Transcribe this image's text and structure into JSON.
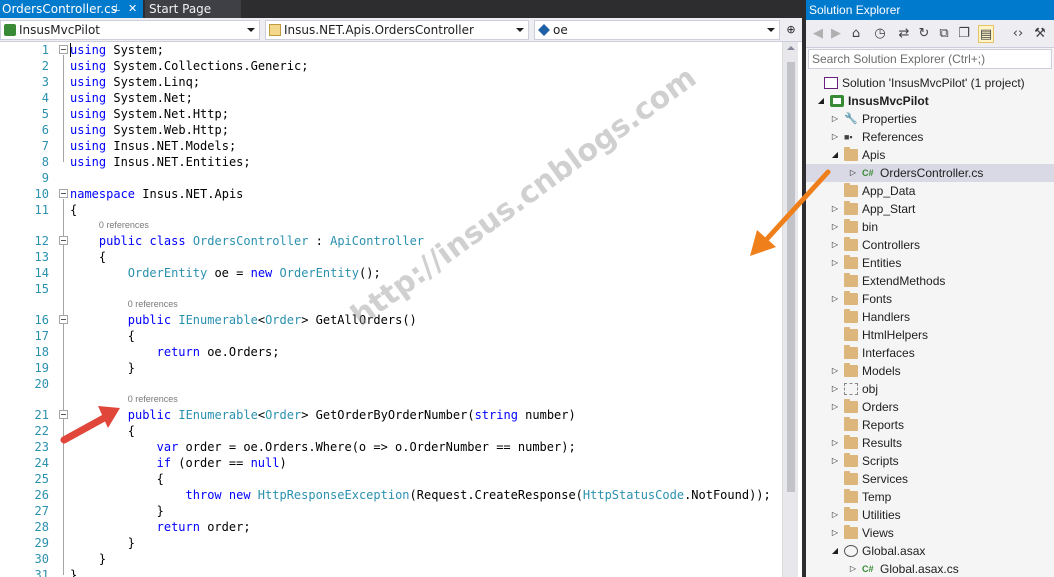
{
  "editor": {
    "tabs": [
      {
        "label": "OrdersController.cs",
        "active": true,
        "pin_icon": "pin-icon",
        "close_icon": "close-icon"
      },
      {
        "label": "Start Page",
        "active": false
      }
    ],
    "nav": {
      "project": "InsusMvcPilot",
      "class": "Insus.NET.Apis.OrdersController",
      "member": "oe"
    },
    "lines": [
      {
        "n": "1",
        "tokens": [
          {
            "t": "using",
            "c": "kw"
          },
          {
            "t": " System;",
            "c": "pl"
          }
        ]
      },
      {
        "n": "2",
        "tokens": [
          {
            "t": "using",
            "c": "kw"
          },
          {
            "t": " System.Collections.Generic;",
            "c": "pl"
          }
        ]
      },
      {
        "n": "3",
        "tokens": [
          {
            "t": "using",
            "c": "kw"
          },
          {
            "t": " System.Linq;",
            "c": "pl"
          }
        ]
      },
      {
        "n": "4",
        "tokens": [
          {
            "t": "using",
            "c": "kw"
          },
          {
            "t": " System.Net;",
            "c": "pl"
          }
        ]
      },
      {
        "n": "5",
        "tokens": [
          {
            "t": "using",
            "c": "kw"
          },
          {
            "t": " System.Net.Http;",
            "c": "pl"
          }
        ]
      },
      {
        "n": "6",
        "tokens": [
          {
            "t": "using",
            "c": "kw"
          },
          {
            "t": " System.Web.Http;",
            "c": "pl"
          }
        ]
      },
      {
        "n": "7",
        "tokens": [
          {
            "t": "using",
            "c": "kw"
          },
          {
            "t": " Insus.NET.Models;",
            "c": "pl"
          }
        ]
      },
      {
        "n": "8",
        "tokens": [
          {
            "t": "using",
            "c": "kw"
          },
          {
            "t": " Insus.NET.Entities;",
            "c": "pl"
          }
        ]
      },
      {
        "n": "9",
        "tokens": []
      },
      {
        "n": "10",
        "tokens": [
          {
            "t": "namespace",
            "c": "kw"
          },
          {
            "t": " Insus.NET.Apis",
            "c": "pl"
          }
        ]
      },
      {
        "n": "11",
        "tokens": [
          {
            "t": "{",
            "c": "pl"
          }
        ]
      },
      {
        "n": "12",
        "ref": "0 references",
        "indent": 4,
        "tokens": [
          {
            "t": "public",
            "c": "kw"
          },
          {
            "t": " ",
            "c": "pl"
          },
          {
            "t": "class",
            "c": "kw"
          },
          {
            "t": " ",
            "c": "pl"
          },
          {
            "t": "OrdersController",
            "c": "ty"
          },
          {
            "t": " : ",
            "c": "pl"
          },
          {
            "t": "ApiController",
            "c": "ty"
          }
        ]
      },
      {
        "n": "13",
        "indent": 4,
        "tokens": [
          {
            "t": "{",
            "c": "pl"
          }
        ]
      },
      {
        "n": "14",
        "indent": 8,
        "tokens": [
          {
            "t": "OrderEntity",
            "c": "ty"
          },
          {
            "t": " oe = ",
            "c": "pl"
          },
          {
            "t": "new",
            "c": "kw"
          },
          {
            "t": " ",
            "c": "pl"
          },
          {
            "t": "OrderEntity",
            "c": "ty"
          },
          {
            "t": "();",
            "c": "pl"
          }
        ]
      },
      {
        "n": "15",
        "tokens": []
      },
      {
        "n": "16",
        "ref": "0 references",
        "indent": 8,
        "tokens": [
          {
            "t": "public",
            "c": "kw"
          },
          {
            "t": " ",
            "c": "pl"
          },
          {
            "t": "IEnumerable",
            "c": "ty"
          },
          {
            "t": "<",
            "c": "pl"
          },
          {
            "t": "Order",
            "c": "ty"
          },
          {
            "t": "> GetAllOrders()",
            "c": "pl"
          }
        ]
      },
      {
        "n": "17",
        "indent": 8,
        "tokens": [
          {
            "t": "{",
            "c": "pl"
          }
        ]
      },
      {
        "n": "18",
        "indent": 12,
        "tokens": [
          {
            "t": "return",
            "c": "kw"
          },
          {
            "t": " oe.Orders;",
            "c": "pl"
          }
        ]
      },
      {
        "n": "19",
        "indent": 8,
        "tokens": [
          {
            "t": "}",
            "c": "pl"
          }
        ]
      },
      {
        "n": "20",
        "tokens": []
      },
      {
        "n": "21",
        "ref": "0 references",
        "indent": 8,
        "tokens": [
          {
            "t": "public",
            "c": "kw"
          },
          {
            "t": " ",
            "c": "pl"
          },
          {
            "t": "IEnumerable",
            "c": "ty"
          },
          {
            "t": "<",
            "c": "pl"
          },
          {
            "t": "Order",
            "c": "ty"
          },
          {
            "t": "> GetOrderByOrderNumber(",
            "c": "pl"
          },
          {
            "t": "string",
            "c": "kw"
          },
          {
            "t": " number)",
            "c": "pl"
          }
        ]
      },
      {
        "n": "22",
        "indent": 8,
        "tokens": [
          {
            "t": "{",
            "c": "pl"
          }
        ]
      },
      {
        "n": "23",
        "indent": 12,
        "tokens": [
          {
            "t": "var",
            "c": "kw"
          },
          {
            "t": " order = oe.Orders.Where(o => o.OrderNumber == number);",
            "c": "pl"
          }
        ]
      },
      {
        "n": "24",
        "indent": 12,
        "tokens": [
          {
            "t": "if",
            "c": "kw"
          },
          {
            "t": " (order == ",
            "c": "pl"
          },
          {
            "t": "null",
            "c": "kw"
          },
          {
            "t": ")",
            "c": "pl"
          }
        ]
      },
      {
        "n": "25",
        "indent": 12,
        "tokens": [
          {
            "t": "{",
            "c": "pl"
          }
        ]
      },
      {
        "n": "26",
        "indent": 16,
        "tokens": [
          {
            "t": "throw",
            "c": "kw"
          },
          {
            "t": " ",
            "c": "pl"
          },
          {
            "t": "new",
            "c": "kw"
          },
          {
            "t": " ",
            "c": "pl"
          },
          {
            "t": "HttpResponseException",
            "c": "ty"
          },
          {
            "t": "(Request.CreateResponse(",
            "c": "pl"
          },
          {
            "t": "HttpStatusCode",
            "c": "ty"
          },
          {
            "t": ".NotFound));",
            "c": "pl"
          }
        ]
      },
      {
        "n": "27",
        "indent": 12,
        "tokens": [
          {
            "t": "}",
            "c": "pl"
          }
        ]
      },
      {
        "n": "28",
        "indent": 12,
        "tokens": [
          {
            "t": "return",
            "c": "kw"
          },
          {
            "t": " order;",
            "c": "pl"
          }
        ]
      },
      {
        "n": "29",
        "indent": 8,
        "tokens": [
          {
            "t": "}",
            "c": "pl"
          }
        ]
      },
      {
        "n": "30",
        "indent": 4,
        "tokens": [
          {
            "t": "}",
            "c": "pl"
          }
        ]
      },
      {
        "n": "31",
        "tokens": [
          {
            "t": "}",
            "c": "pl"
          }
        ]
      }
    ],
    "colors": {
      "keyword": "#0000ff",
      "type": "#2b91af",
      "line_number": "#2b91af",
      "tab_active": "#007acc"
    }
  },
  "solution_explorer": {
    "title": "Solution Explorer",
    "title_icons": [
      "pin-icon",
      "close-icon"
    ],
    "toolbar": [
      "back-icon",
      "forward-icon",
      "home-icon",
      "history-icon",
      "sync-icon",
      "refresh-icon",
      "collapse-all-icon",
      "show-all-files-icon",
      "view-code-icon",
      "properties-icon"
    ],
    "search_placeholder": "Search Solution Explorer (Ctrl+;)",
    "tree": [
      {
        "label": "Solution 'InsusMvcPilot' (1 project)",
        "icon": "solution-icon",
        "depth": 0,
        "expander": ""
      },
      {
        "label": "InsusMvcPilot",
        "icon": "project-icon",
        "depth": 0,
        "expander": "expanded",
        "bold": true
      },
      {
        "label": "Properties",
        "icon": "wrench-icon",
        "depth": 1,
        "expander": "collapsed"
      },
      {
        "label": "References",
        "icon": "references-icon",
        "depth": 1,
        "expander": "collapsed"
      },
      {
        "label": "Apis",
        "icon": "folder-open-icon",
        "depth": 1,
        "expander": "expanded"
      },
      {
        "label": "OrdersController.cs",
        "icon": "csharp-file-icon",
        "depth": 2,
        "expander": "collapsed",
        "selected": true
      },
      {
        "label": "App_Data",
        "icon": "folder-icon",
        "depth": 1,
        "expander": ""
      },
      {
        "label": "App_Start",
        "icon": "folder-icon",
        "depth": 1,
        "expander": "collapsed"
      },
      {
        "label": "bin",
        "icon": "folder-icon",
        "depth": 1,
        "expander": "collapsed"
      },
      {
        "label": "Controllers",
        "icon": "folder-icon",
        "depth": 1,
        "expander": "collapsed"
      },
      {
        "label": "Entities",
        "icon": "folder-icon",
        "depth": 1,
        "expander": "collapsed"
      },
      {
        "label": "ExtendMethods",
        "icon": "folder-icon",
        "depth": 1,
        "expander": ""
      },
      {
        "label": "Fonts",
        "icon": "folder-icon",
        "depth": 1,
        "expander": "collapsed"
      },
      {
        "label": "Handlers",
        "icon": "folder-icon",
        "depth": 1,
        "expander": ""
      },
      {
        "label": "HtmlHelpers",
        "icon": "folder-icon",
        "depth": 1,
        "expander": ""
      },
      {
        "label": "Interfaces",
        "icon": "folder-icon",
        "depth": 1,
        "expander": ""
      },
      {
        "label": "Models",
        "icon": "folder-icon",
        "depth": 1,
        "expander": "collapsed"
      },
      {
        "label": "obj",
        "icon": "folder-dotted-icon",
        "depth": 1,
        "expander": "collapsed"
      },
      {
        "label": "Orders",
        "icon": "folder-icon",
        "depth": 1,
        "expander": "collapsed"
      },
      {
        "label": "Reports",
        "icon": "folder-icon",
        "depth": 1,
        "expander": ""
      },
      {
        "label": "Results",
        "icon": "folder-icon",
        "depth": 1,
        "expander": "collapsed"
      },
      {
        "label": "Scripts",
        "icon": "folder-icon",
        "depth": 1,
        "expander": "collapsed"
      },
      {
        "label": "Services",
        "icon": "folder-icon",
        "depth": 1,
        "expander": ""
      },
      {
        "label": "Temp",
        "icon": "folder-icon",
        "depth": 1,
        "expander": ""
      },
      {
        "label": "Utilities",
        "icon": "folder-icon",
        "depth": 1,
        "expander": "collapsed"
      },
      {
        "label": "Views",
        "icon": "folder-icon",
        "depth": 1,
        "expander": "collapsed"
      },
      {
        "label": "Global.asax",
        "icon": "global-asax-icon",
        "depth": 1,
        "expander": "expanded"
      },
      {
        "label": "Global.asax.cs",
        "icon": "csharp-file-icon",
        "depth": 2,
        "expander": "collapsed"
      }
    ]
  },
  "watermark": "http://insus.cnblogs.com",
  "annotations": {
    "arrow_colors": [
      "#ef7f1a",
      "#e0473a"
    ]
  }
}
